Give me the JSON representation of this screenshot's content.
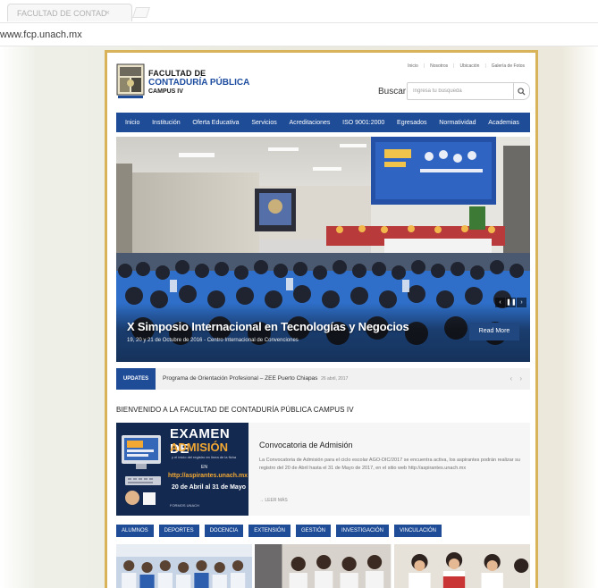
{
  "browser": {
    "tab_title": "FACULTAD DE CONTAD",
    "tab_close": "×",
    "url": "www.fcp.unach.mx"
  },
  "header": {
    "logo": {
      "line1": "FACULTAD DE",
      "line2": "CONTADURÍA PÚBLICA",
      "line3": "CAMPUS IV"
    },
    "top_links": [
      "Inicio",
      "Nosotros",
      "Ubicación",
      "Galería de Fotos"
    ],
    "search": {
      "label": "Buscar",
      "placeholder": "Ingresa tu búsqueda",
      "button_icon": "search-icon"
    }
  },
  "nav": {
    "items": [
      "Inicio",
      "Institución",
      "Oferta Educativa",
      "Servicios",
      "Acreditaciones",
      "ISO 9001:2000",
      "Egresados",
      "Normatividad",
      "Academias"
    ]
  },
  "slider": {
    "title": "X Simposio Internacional en Tecnologías y Negocios",
    "subtitle": "19, 20 y 21 de Octubre de 2016 - Centro Internacional de Convenciones",
    "read_more": "Read More",
    "controls": [
      "‹",
      "❚❚",
      "›"
    ]
  },
  "updates": {
    "badge": "UPDATES",
    "text": "Programa de Orientación Profesional – ZEE Puerto Chiapas",
    "date": "26 abril, 2017",
    "arrows": "‹ ›"
  },
  "welcome": {
    "heading": "BIENVENIDO A LA FACULTAD DE CONTADURÍA PÚBLICA CAMPUS IV"
  },
  "feature": {
    "banner": {
      "line1": "EXAMEN DE",
      "line2": "ADMISIÓN",
      "small": "y el inicio del registro en línea de la ficha",
      "en": "EN",
      "url": "http://aspirantes.unach.mx",
      "dates": "20 de Abril al 31 de Mayo",
      "foot": "FORMOS UNACH"
    },
    "title": "Convocatoria de Admisión",
    "text": "La Convocatoria de Admisión para el ciclo escolar AGO-DIC/2017 se encuentra activa, los aspirantes podrán realizar su registro del 20 de Abril hasta el 31 de Mayo de 2017, en el sitio web http://aspirantes.unach.mx",
    "more": "→ LEER MÁS"
  },
  "categories": [
    "ALUMNOS",
    "DEPORTES",
    "DOCENCIA",
    "EXTENSIÓN",
    "GESTIÓN",
    "INVESTIGACIÓN",
    "VINCULACIÓN"
  ],
  "colors": {
    "nav_blue": "#1e4c97",
    "gold_border": "#d8b35a",
    "accent_orange": "#f2a833"
  }
}
